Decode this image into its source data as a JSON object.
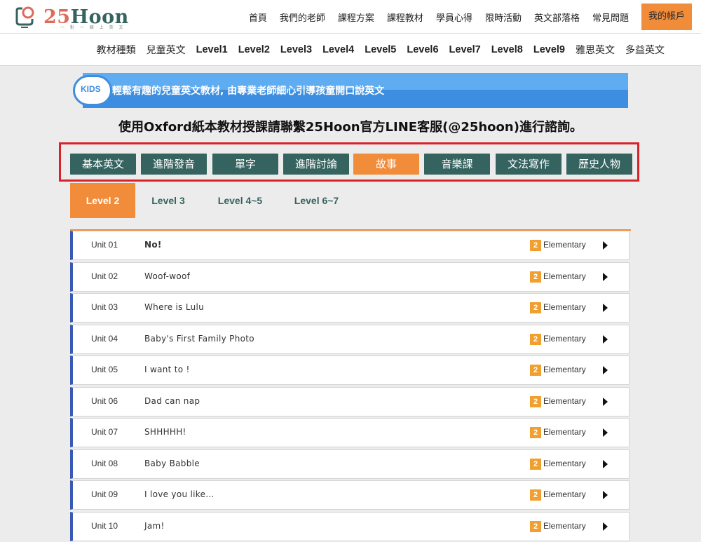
{
  "header": {
    "logo_number": "25",
    "logo_word": "Hoon",
    "logo_tagline": "一 對 一 線 上 英 文",
    "nav": [
      "首頁",
      "我們的老師",
      "課程方案",
      "課程教材",
      "學員心得",
      "限時活動",
      "英文部落格",
      "常見問題"
    ],
    "account_label": "我的帳戶"
  },
  "categories": [
    "教材種類",
    "兒童英文",
    "Level1",
    "Level2",
    "Level3",
    "Level4",
    "Level5",
    "Level6",
    "Level7",
    "Level8",
    "Level9",
    "雅思英文",
    "多益英文"
  ],
  "banner": {
    "badge": "KIDS",
    "text": "輕鬆有趣的兒童英文教材, 由專業老師細心引導孩童開口說英文"
  },
  "notice": "使用Oxford紙本教材授課請聯繫25Hoon官方LINE客服(@25hoon)進行諮詢。",
  "subjects": [
    "基本英文",
    "進階發音",
    "單字",
    "進階討論",
    "故事",
    "音樂課",
    "文法寫作",
    "歷史人物"
  ],
  "active_subject": "故事",
  "levels": [
    "Level 2",
    "Level 3",
    "Level 4~5",
    "Level 6~7"
  ],
  "active_level": "Level 2",
  "units": [
    {
      "unit": "Unit 01",
      "title": "No!",
      "level": "2",
      "level_name": "Elementary"
    },
    {
      "unit": "Unit 02",
      "title": "Woof-woof",
      "level": "2",
      "level_name": "Elementary"
    },
    {
      "unit": "Unit 03",
      "title": "Where is Lulu",
      "level": "2",
      "level_name": "Elementary"
    },
    {
      "unit": "Unit 04",
      "title": "Baby's First Family Photo",
      "level": "2",
      "level_name": "Elementary"
    },
    {
      "unit": "Unit 05",
      "title": "I want to !",
      "level": "2",
      "level_name": "Elementary"
    },
    {
      "unit": "Unit 06",
      "title": "Dad can nap",
      "level": "2",
      "level_name": "Elementary"
    },
    {
      "unit": "Unit 07",
      "title": "SHHHHH!",
      "level": "2",
      "level_name": "Elementary"
    },
    {
      "unit": "Unit 08",
      "title": "Baby Babble",
      "level": "2",
      "level_name": "Elementary"
    },
    {
      "unit": "Unit 09",
      "title": "I love you like…",
      "level": "2",
      "level_name": "Elementary"
    },
    {
      "unit": "Unit 10",
      "title": "Jam!",
      "level": "2",
      "level_name": "Elementary"
    }
  ],
  "colors": {
    "brand_green": "#35635f",
    "brand_orange": "#f18c3a",
    "logo_red": "#e06a5a",
    "kids_blue": "#3d8ee0",
    "highlight_red": "#d8232a",
    "row_accent": "#3a59b5"
  }
}
